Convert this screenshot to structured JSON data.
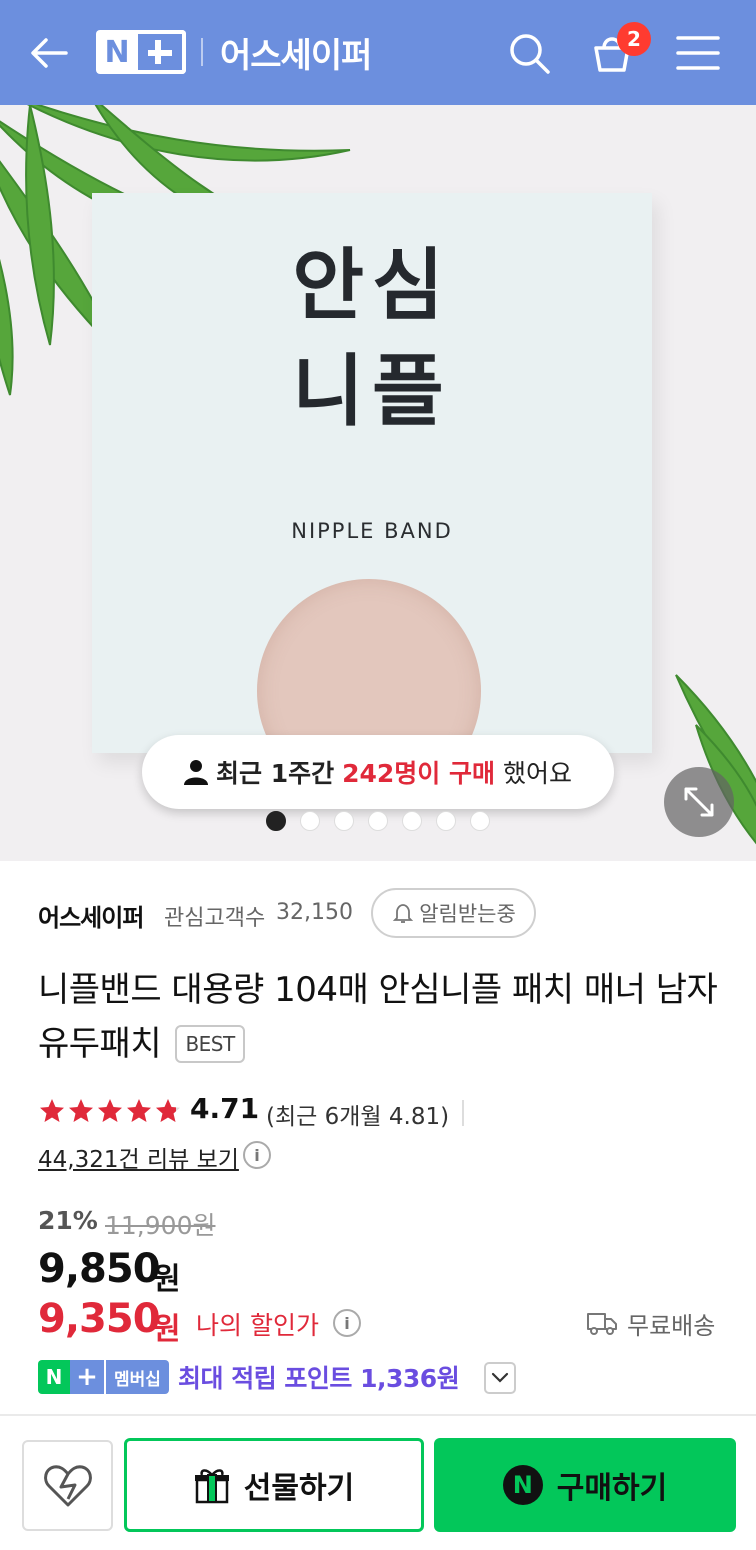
{
  "header": {
    "logo_n": "N",
    "store_name": "어스세이퍼",
    "cart_count": "2",
    "accent": "#6c8fde"
  },
  "hero": {
    "box_title_line1": "안심",
    "box_title_line2": "니플",
    "box_subtitle": "NIPPLE BAND",
    "purchase_prefix": "최근 1주간",
    "purchase_highlight": "242명이 구매",
    "purchase_suffix": "했어요",
    "image_count": 7,
    "active_image": 1
  },
  "seller": {
    "name": "어스세이퍼",
    "follower_label": "관심고객수",
    "follower_count": "32,150",
    "alarm_label": "알림받는중"
  },
  "product": {
    "title": "니플밴드 대용량 104매 안심니플 패치 매너 남자 유두패치",
    "badge": "BEST",
    "rating": "4.71",
    "rating_fraction": 0.942,
    "recent_rating": "(최근 6개월 4.81)",
    "review_link": "44,321건 리뷰 보기",
    "info_glyph": "i"
  },
  "price": {
    "discount_rate": "21%",
    "original": "11,900원",
    "sale": "9,850",
    "currency": "원",
    "my_price": "9,350",
    "my_price_label": "나의 할인가",
    "shipping": "무료배송",
    "sale_color": "#e0293a"
  },
  "membership": {
    "n": "N",
    "plus": "+",
    "label": "멤버십",
    "point_text": "최대 적립 포인트 1,336원"
  },
  "actions": {
    "wish_icon": "heart-icon",
    "gift_label": "선물하기",
    "buy_n": "N",
    "buy_label": "구매하기",
    "buy_color": "#03c75a"
  }
}
